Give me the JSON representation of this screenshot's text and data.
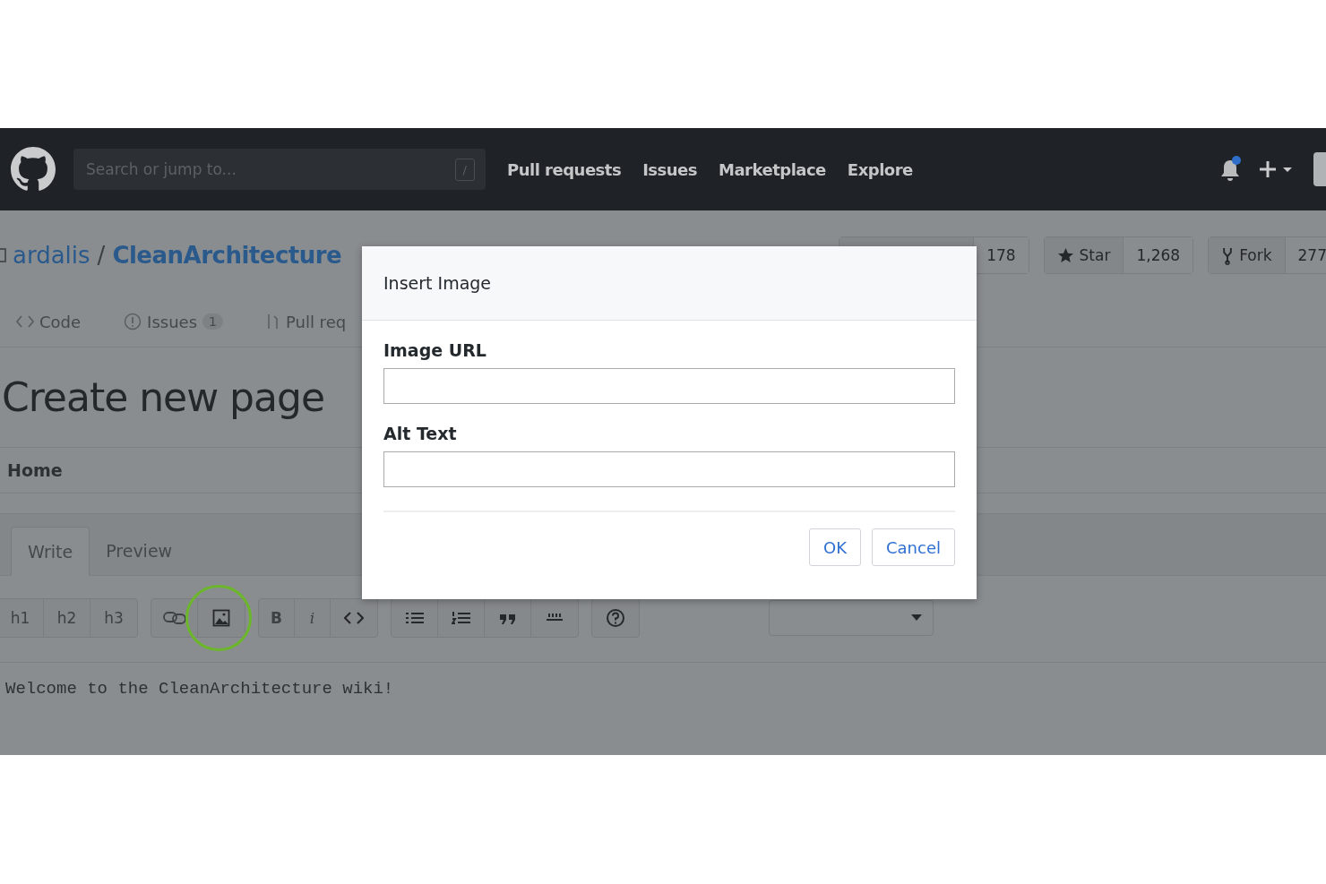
{
  "header": {
    "search": {
      "placeholder": "Search or jump to...",
      "shortcut": "/"
    },
    "nav": [
      "Pull requests",
      "Issues",
      "Marketplace",
      "Explore"
    ],
    "notifications": {
      "unread": true
    }
  },
  "repo": {
    "owner": "ardalis",
    "separator": "/",
    "name": "CleanArchitecture",
    "counters": [
      {
        "count": "178"
      },
      {
        "label": "Star",
        "count": "1,268"
      },
      {
        "label": "Fork",
        "count": "277"
      }
    ]
  },
  "repo_tabs": [
    {
      "label": "Code"
    },
    {
      "label": "Issues",
      "counter": "1"
    },
    {
      "label": "Pull req"
    }
  ],
  "page_title": "Create new page",
  "page_name": {
    "value": "Home"
  },
  "editor_tabs": [
    {
      "label": "Write",
      "selected": true
    },
    {
      "label": "Preview",
      "selected": false
    }
  ],
  "toolbar": {
    "heading_buttons": [
      "h1",
      "h2",
      "h3"
    ],
    "format_buttons": [
      "B",
      "i"
    ],
    "image_button": {
      "highlighted": true
    }
  },
  "editor": {
    "text": "Welcome to the CleanArchitecture wiki!"
  },
  "dialog": {
    "title": "Insert Image",
    "fields": [
      {
        "label": "Image URL"
      },
      {
        "label": "Alt Text"
      }
    ],
    "buttons": [
      "OK",
      "Cancel"
    ]
  }
}
